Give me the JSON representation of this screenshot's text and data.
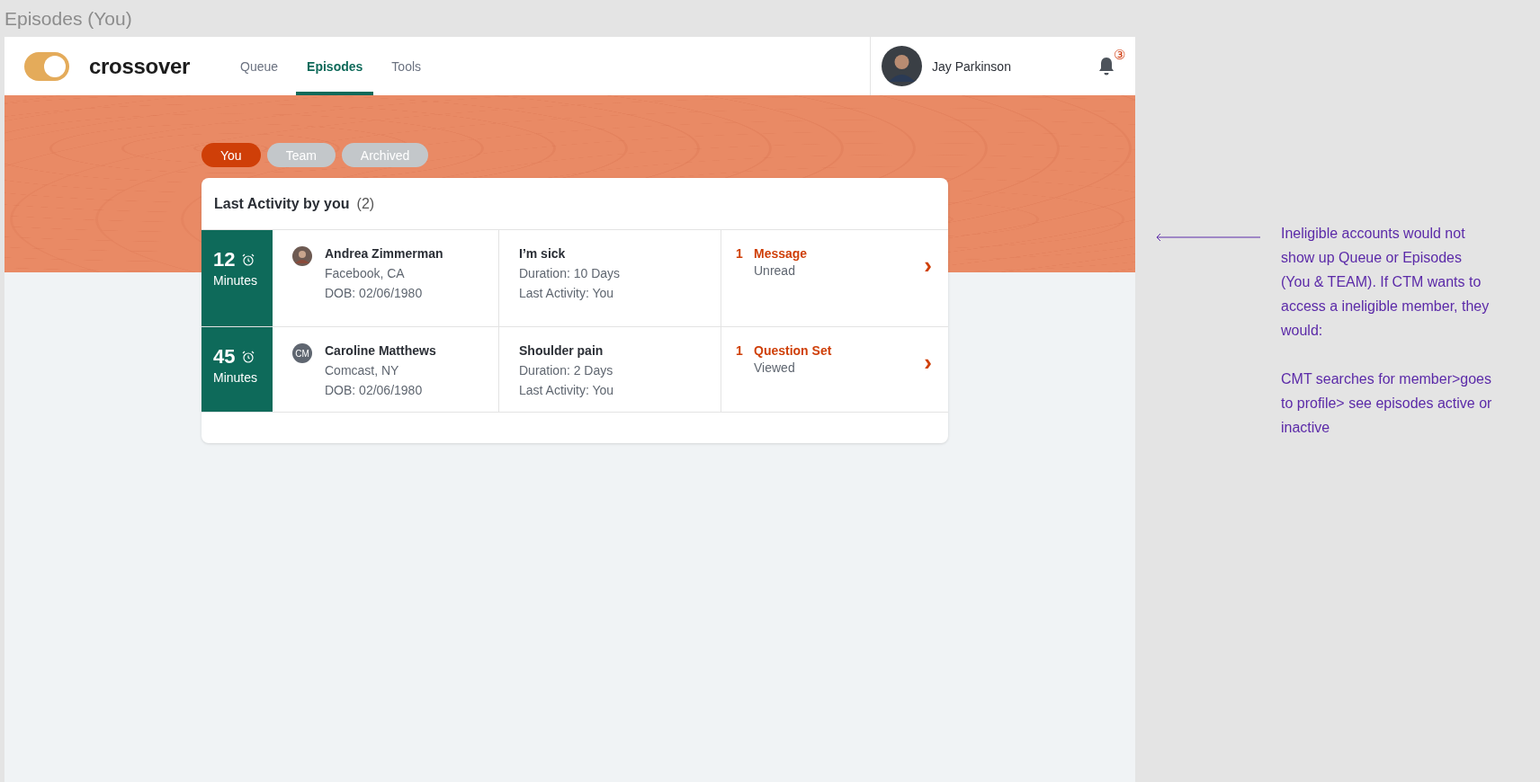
{
  "page_title": "Episodes (You)",
  "header": {
    "toggle": {
      "on": true
    },
    "brand": "crossover",
    "nav": [
      {
        "label": "Queue",
        "selected": false
      },
      {
        "label": "Episodes",
        "selected": true
      },
      {
        "label": "Tools",
        "selected": false
      }
    ],
    "user": {
      "name": "Jay Parkinson"
    },
    "notifications": {
      "count": "③"
    }
  },
  "filters": [
    {
      "label": "You",
      "selected": true
    },
    {
      "label": "Team",
      "selected": false
    },
    {
      "label": "Archived",
      "selected": false
    }
  ],
  "card": {
    "title": "Last Activity by you",
    "count": "(2)",
    "rows": [
      {
        "time": "12",
        "unit": "Minutes",
        "avatar": {
          "kind": "photo"
        },
        "name": "Andrea Zimmerman",
        "location": "Facebook, CA",
        "dob": "DOB: 02/06/1980",
        "complaint": "I’m sick",
        "duration": "Duration: 10 Days",
        "last_activity": "Last Activity: You",
        "status_count": "1",
        "status_type": "Message",
        "status_state": "Unread",
        "chevron": "›"
      },
      {
        "time": "45",
        "unit": "Minutes",
        "avatar": {
          "kind": "initials",
          "initials": "CM"
        },
        "name": "Caroline Matthews",
        "location": "Comcast, NY",
        "dob": "DOB: 02/06/1980",
        "complaint": "Shoulder pain",
        "duration": "Duration: 2 Days",
        "last_activity": "Last Activity: You",
        "status_count": "1",
        "status_type": "Question Set",
        "status_state": "Viewed",
        "chevron": "›"
      }
    ]
  },
  "annotation": {
    "paragraphs": [
      "Ineligible accounts would not show up Queue or Episodes (You & TEAM).  If CTM wants to access a ineligible member, they would:",
      "CMT searches for member>goes to profile> see episodes active or inactive"
    ]
  }
}
